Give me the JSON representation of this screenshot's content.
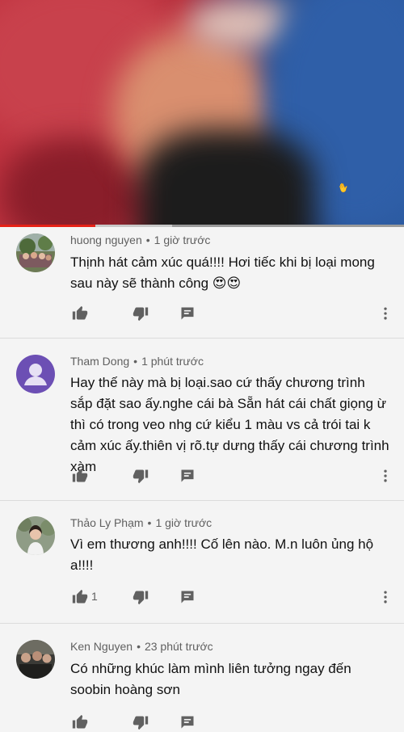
{
  "video": {
    "watermark_icon": "voice-logo-icon",
    "progress": 0.235,
    "buffered": 0.19
  },
  "comments": [
    {
      "author": "huong nguyen",
      "time": "1 giờ trước",
      "text": "Thịnh hát cảm xúc quá!!!!  Hơi tiếc khi bị loại mong sau này sẽ thành công 😍😍",
      "likes": "",
      "avatar": "photo-avatar"
    },
    {
      "author": "Tham Dong",
      "time": "1 phút trước",
      "text": "Hay thế này mà bị loại.sao cứ thấy chương trình sắp đặt sao ấy.nghe cái bà Sẵn hát cái chất giọng ừ thì có trong veo nhg cứ kiểu 1 màu vs cả trói tai k cảm xúc ấy.thiên vị rõ.tự dưng thấy cái chương trình xàm",
      "likes": "",
      "avatar": "default-user-avatar"
    },
    {
      "author": "Thảo Ly Phạm",
      "time": "1 giờ trước",
      "text": "Vì em thương anh!!!!  Cố lên nào. M.n luôn ủng hộ a!!!!",
      "likes": "1",
      "avatar": "photo-avatar"
    },
    {
      "author": "Ken Nguyen",
      "time": "23 phút trước",
      "text": "Có những khúc làm mình liên tưởng ngay đến soobin hoàng sơn",
      "likes": "",
      "avatar": "photo-avatar"
    }
  ],
  "icons": {
    "like": "thumb-up-icon",
    "dislike": "thumb-down-icon",
    "reply": "comment-icon",
    "more": "more-vert-icon"
  },
  "colors": {
    "progress": "#e62117",
    "meta_text": "#606060",
    "icon": "#606060",
    "avatar_default": "#6c4fb4"
  }
}
